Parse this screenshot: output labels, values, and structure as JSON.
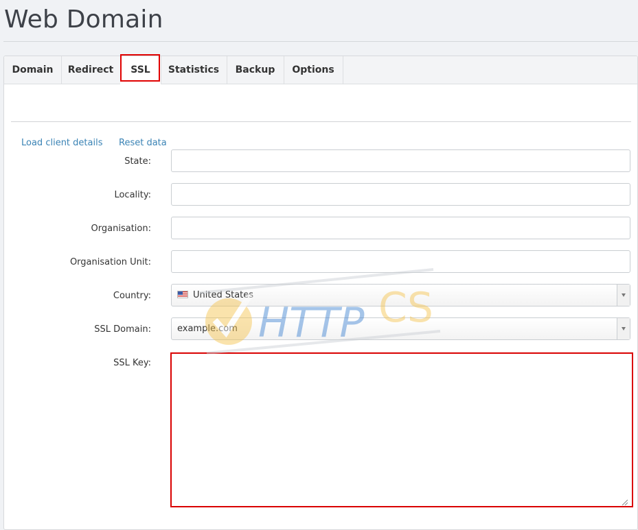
{
  "page": {
    "title": "Web Domain"
  },
  "tabs": [
    {
      "label": "Domain"
    },
    {
      "label": "Redirect"
    },
    {
      "label": "SSL"
    },
    {
      "label": "Statistics"
    },
    {
      "label": "Backup"
    },
    {
      "label": "Options"
    }
  ],
  "active_tab": "SSL",
  "links": {
    "load_client": "Load client details",
    "reset": "Reset data"
  },
  "form": {
    "state": {
      "label": "State:",
      "value": ""
    },
    "locality": {
      "label": "Locality:",
      "value": ""
    },
    "organisation": {
      "label": "Organisation:",
      "value": ""
    },
    "organisation_unit": {
      "label": "Organisation Unit:",
      "value": ""
    },
    "country": {
      "label": "Country:",
      "value": "United States",
      "flag_icon": "us-flag-icon"
    },
    "ssl_domain": {
      "label": "SSL Domain:",
      "value": "example.com"
    },
    "ssl_key": {
      "label": "SSL Key:",
      "value": ""
    }
  },
  "watermark": {
    "text_a": "HTTP",
    "text_b": "CS"
  },
  "colors": {
    "link": "#3a83b5",
    "highlight": "#e00000",
    "watermark_blue": "#3a7fd0",
    "watermark_orange": "#f5c24a"
  }
}
